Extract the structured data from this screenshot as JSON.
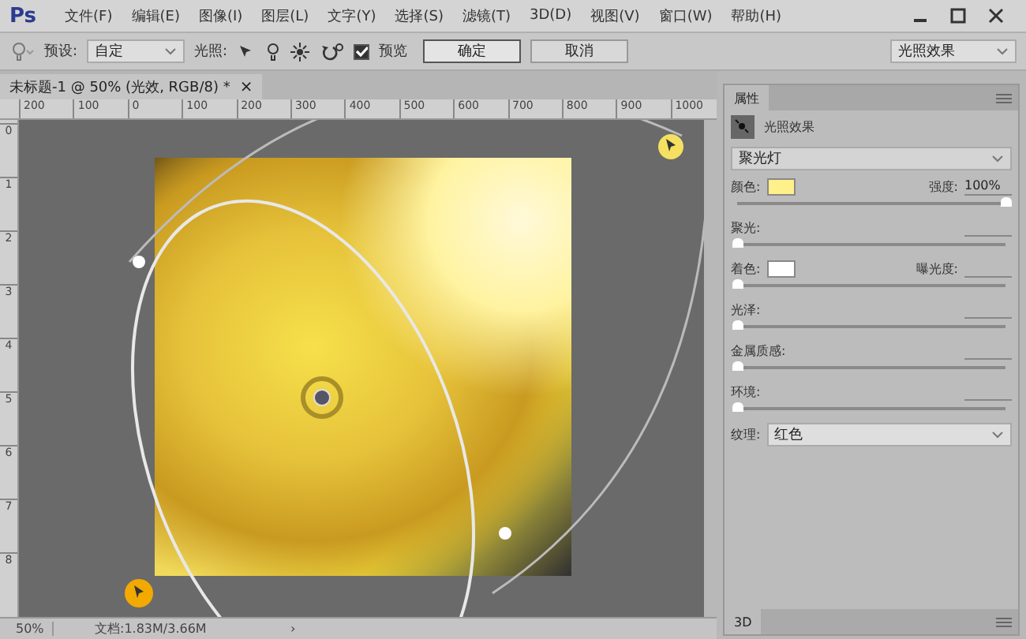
{
  "app": {
    "logo": "Ps",
    "menu": [
      "文件(F)",
      "编辑(E)",
      "图像(I)",
      "图层(L)",
      "文字(Y)",
      "选择(S)",
      "滤镜(T)",
      "3D(D)",
      "视图(V)",
      "窗口(W)",
      "帮助(H)"
    ]
  },
  "options_bar": {
    "preset_label": "预设:",
    "preset_value": "自定",
    "lights_label": "光照:",
    "preview": {
      "label": "预览",
      "checked": true
    },
    "ok": "确定",
    "cancel": "取消",
    "workspace": "光照效果"
  },
  "document_tab": {
    "title": "未标题-1 @ 50% (光效, RGB/8) *",
    "close": "×"
  },
  "ruler": {
    "horizontal": [
      "200",
      "100",
      "0",
      "100",
      "200",
      "300",
      "400",
      "500",
      "600",
      "700",
      "800",
      "900",
      "1000"
    ],
    "vertical": [
      "0",
      "1",
      "2",
      "3",
      "4",
      "5",
      "6",
      "7",
      "8"
    ]
  },
  "status_bar": {
    "zoom": "50%",
    "doc": "文档:1.83M/3.66M",
    "arrow": "›"
  },
  "properties": {
    "tab": "属性",
    "header": "光照效果",
    "light_type": "聚光灯",
    "rows": [
      {
        "kind": "color",
        "label": "颜色:",
        "color": "#fff08a",
        "right_label": "强度:",
        "right_value": "100%",
        "level": 1.0
      },
      {
        "kind": "slider",
        "label": "聚光:",
        "level": 0
      },
      {
        "kind": "color",
        "label": "着色:",
        "color": "#ffffff",
        "right_label": "曝光度:",
        "level": 0
      },
      {
        "kind": "slider",
        "label": "光泽:",
        "level": 0
      },
      {
        "kind": "slider",
        "label": "金属质感:",
        "level": 0
      },
      {
        "kind": "slider",
        "label": "环境:",
        "level": 0
      }
    ],
    "texture_label": "纹理:",
    "texture_value": "红色",
    "footer_tab": "3D"
  }
}
